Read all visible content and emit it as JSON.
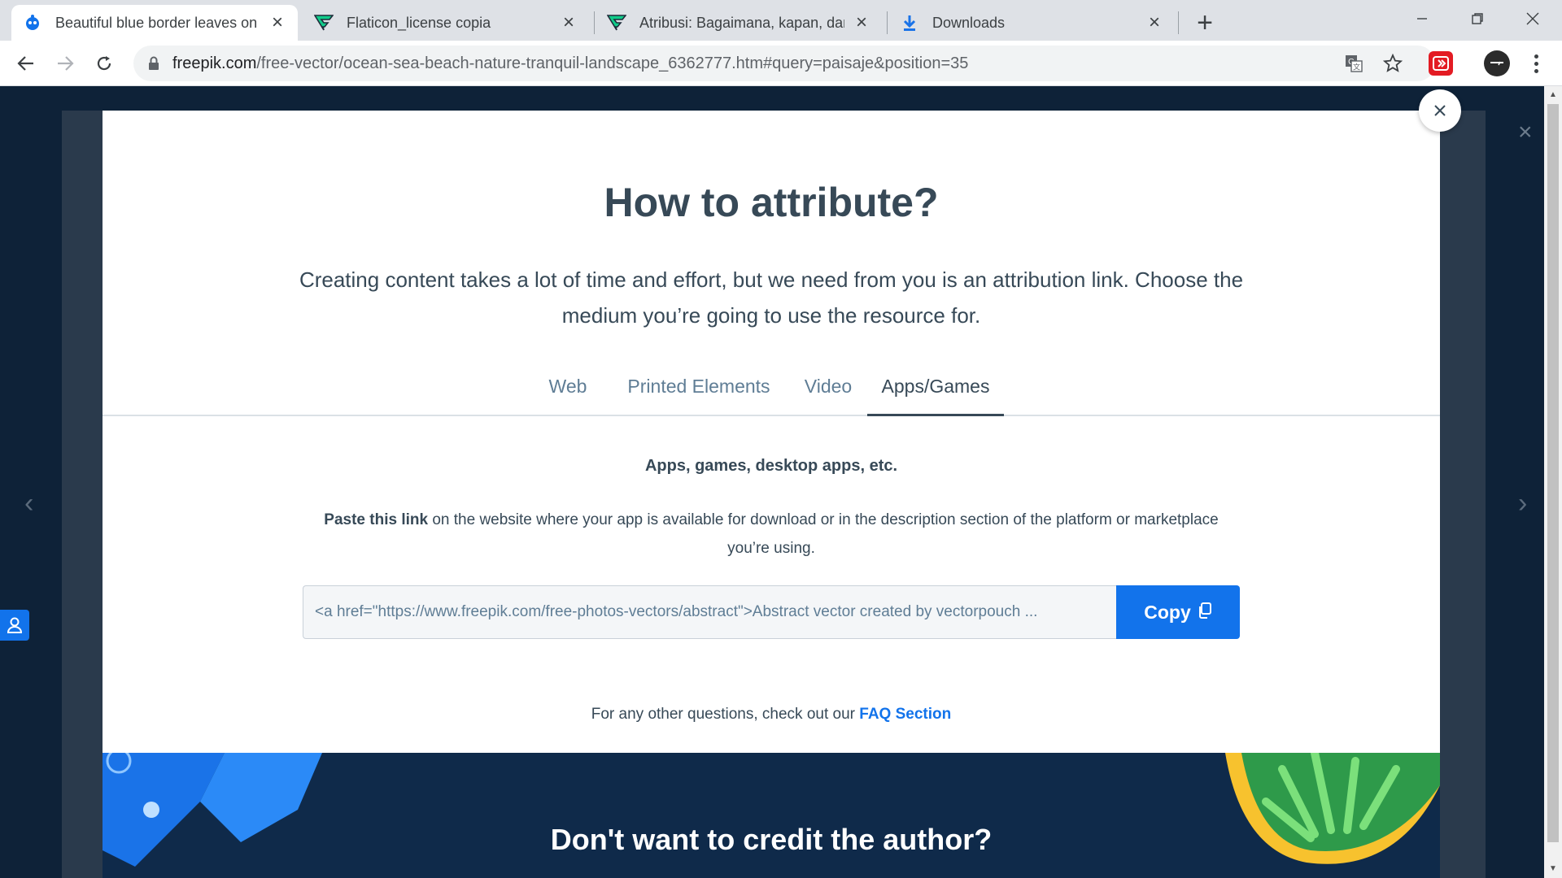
{
  "browser": {
    "tabs": [
      {
        "title": "Beautiful blue border leaves on p",
        "icon": "freepik-icon",
        "active": true
      },
      {
        "title": "Flaticon_license copia",
        "icon": "flaticon-icon",
        "active": false
      },
      {
        "title": "Atribusi: Bagaimana, kapan, dan ",
        "icon": "flaticon-icon",
        "active": false
      },
      {
        "title": "Downloads",
        "icon": "download-icon",
        "active": false
      }
    ],
    "url_host": "freepik.com",
    "url_rest": "/free-vector/ocean-sea-beach-nature-tranquil-landscape_6362777.htm#query=paisaje&position=35"
  },
  "modal": {
    "title": "How to attribute?",
    "intro": "Creating content takes a lot of time and effort, but we need from you is an attribution link. Choose the medium you’re going to use the resource for.",
    "tabs": [
      {
        "label": "Web"
      },
      {
        "label": "Printed Elements"
      },
      {
        "label": "Video"
      },
      {
        "label": "Apps/Games"
      }
    ],
    "active_tab": "Apps/Games",
    "section_subtitle": "Apps, games, desktop apps, etc.",
    "desc_bold": "Paste this link",
    "desc_rest": " on the website where your app is available for download or in the description section of the platform or marketplace you’re using.",
    "attribution_code": "<a href=\"https://www.freepik.com/free-photos-vectors/abstract\">Abstract vector created by vectorpouch ...",
    "copy_label": "Copy",
    "faq_prefix": "For any other questions, check out our ",
    "faq_link": "FAQ Section"
  },
  "promo": {
    "title": "Don't want to credit the author?"
  },
  "colors": {
    "accent": "#1273eb",
    "text": "#374957",
    "muted": "#5f7d95"
  }
}
